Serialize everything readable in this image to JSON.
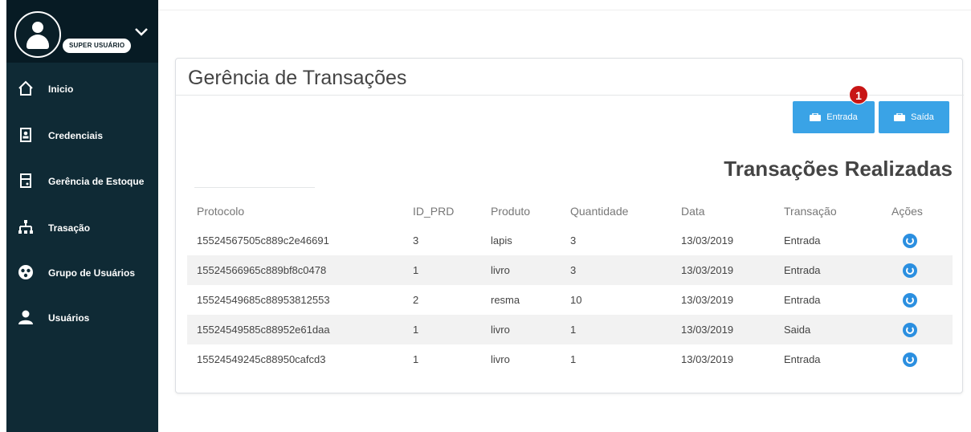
{
  "sidebar": {
    "user_badge": "SUPER USUÁRIO",
    "items": [
      {
        "label": "Inicio",
        "icon": "home-icon"
      },
      {
        "label": "Credenciais",
        "icon": "id-card-icon"
      },
      {
        "label": "Gerência de Estoque",
        "icon": "inventory-icon"
      },
      {
        "label": "Trasação",
        "icon": "sitemap-icon"
      },
      {
        "label": "Grupo de Usuários",
        "icon": "user-group-icon"
      },
      {
        "label": "Usuários",
        "icon": "user-icon"
      }
    ]
  },
  "main": {
    "title": "Gerência de Transações",
    "buttons": {
      "entrada": "Entrada",
      "saida": "Saída"
    },
    "step_badge": "1",
    "section_title": "Transações Realizadas",
    "table": {
      "headers": [
        "Protocolo",
        "ID_PRD",
        "Produto",
        "Quantidade",
        "Data",
        "Transação",
        "Ações"
      ],
      "rows": [
        [
          "15524567505c889c2e46691",
          "3",
          "lapis",
          "3",
          "13/03/2019",
          "Entrada"
        ],
        [
          "15524566965c889bf8c0478",
          "1",
          "livro",
          "3",
          "13/03/2019",
          "Entrada"
        ],
        [
          "15524549685c88953812553",
          "2",
          "resma",
          "10",
          "13/03/2019",
          "Entrada"
        ],
        [
          "15524549585c88952e61daa",
          "1",
          "livro",
          "1",
          "13/03/2019",
          "Saida"
        ],
        [
          "15524549245c88950cafcd3",
          "1",
          "livro",
          "1",
          "13/03/2019",
          "Entrada"
        ]
      ]
    }
  },
  "colors": {
    "sidebar_bg": "#0f2a35",
    "sidebar_header_bg": "#071b24",
    "button_blue": "#3aa3e6",
    "badge_red": "#c81515",
    "action_blue": "#2b8fe0"
  }
}
